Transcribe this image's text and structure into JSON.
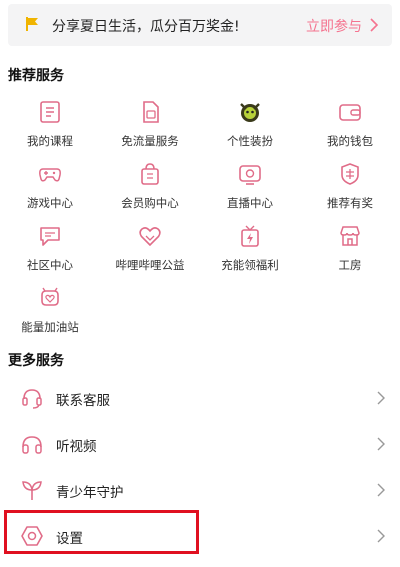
{
  "colors": {
    "accent": "#f5738f",
    "banner_bg": "#f4f4f5",
    "highlight": "#e01020"
  },
  "banner": {
    "icon": "flag-icon",
    "text": "分享夏日生活，瓜分百万奖金!",
    "link": "立即参与",
    "chevron": "chevron-right-icon"
  },
  "recommended": {
    "title": "推荐服务",
    "items": [
      {
        "label": "我的课程",
        "icon": "course-icon"
      },
      {
        "label": "免流量服务",
        "icon": "sim-card-icon"
      },
      {
        "label": "个性装扮",
        "icon": "avatar-decoration-icon"
      },
      {
        "label": "我的钱包",
        "icon": "wallet-icon"
      },
      {
        "label": "游戏中心",
        "icon": "gamepad-icon"
      },
      {
        "label": "会员购中心",
        "icon": "shopping-bag-icon"
      },
      {
        "label": "直播中心",
        "icon": "live-tv-icon"
      },
      {
        "label": "推荐有奖",
        "icon": "reward-badge-icon"
      },
      {
        "label": "社区中心",
        "icon": "community-chat-icon"
      },
      {
        "label": "哔哩哔哩公益",
        "icon": "charity-heart-icon"
      },
      {
        "label": "充能领福利",
        "icon": "charge-gift-icon"
      },
      {
        "label": "工房",
        "icon": "shop-icon"
      },
      {
        "label": "能量加油站",
        "icon": "energy-station-icon"
      }
    ]
  },
  "more": {
    "title": "更多服务",
    "items": [
      {
        "label": "联系客服",
        "icon": "headset-icon"
      },
      {
        "label": "听视频",
        "icon": "headphones-icon"
      },
      {
        "label": "青少年守护",
        "icon": "sprout-icon"
      },
      {
        "label": "设置",
        "icon": "settings-hexagon-icon"
      }
    ]
  }
}
